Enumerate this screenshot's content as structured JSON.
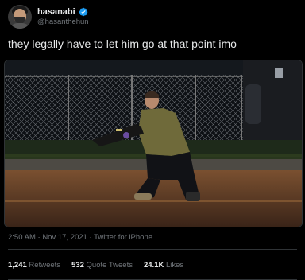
{
  "author": {
    "display_name": "hasanabi",
    "handle": "@hasanthehun",
    "verified_icon": "verified-badge-icon",
    "accent_color": "#1d9bf0"
  },
  "tweet": {
    "text": "they legally have to let him go at that point imo"
  },
  "meta": {
    "time": "2:50 AM",
    "separator1": " · ",
    "date": "Nov 17, 2021",
    "separator2": " · ",
    "source": "Twitter for iPhone"
  },
  "stats": {
    "retweets_count": "1,241",
    "retweets_label": "Retweets",
    "quotes_count": "532",
    "quotes_label": "Quote Tweets",
    "likes_count": "24.1K",
    "likes_label": "Likes"
  }
}
